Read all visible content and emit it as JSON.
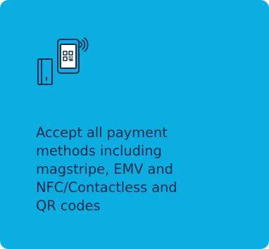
{
  "card": {
    "background": "#0aaee0",
    "text_color": "#142a4f",
    "icon": "payment-terminal-qr-card-icon",
    "description_lines": [
      "Accept all payment",
      "methods including",
      "magstripe, EMV and",
      "NFC/Contactless and",
      "QR codes"
    ]
  }
}
